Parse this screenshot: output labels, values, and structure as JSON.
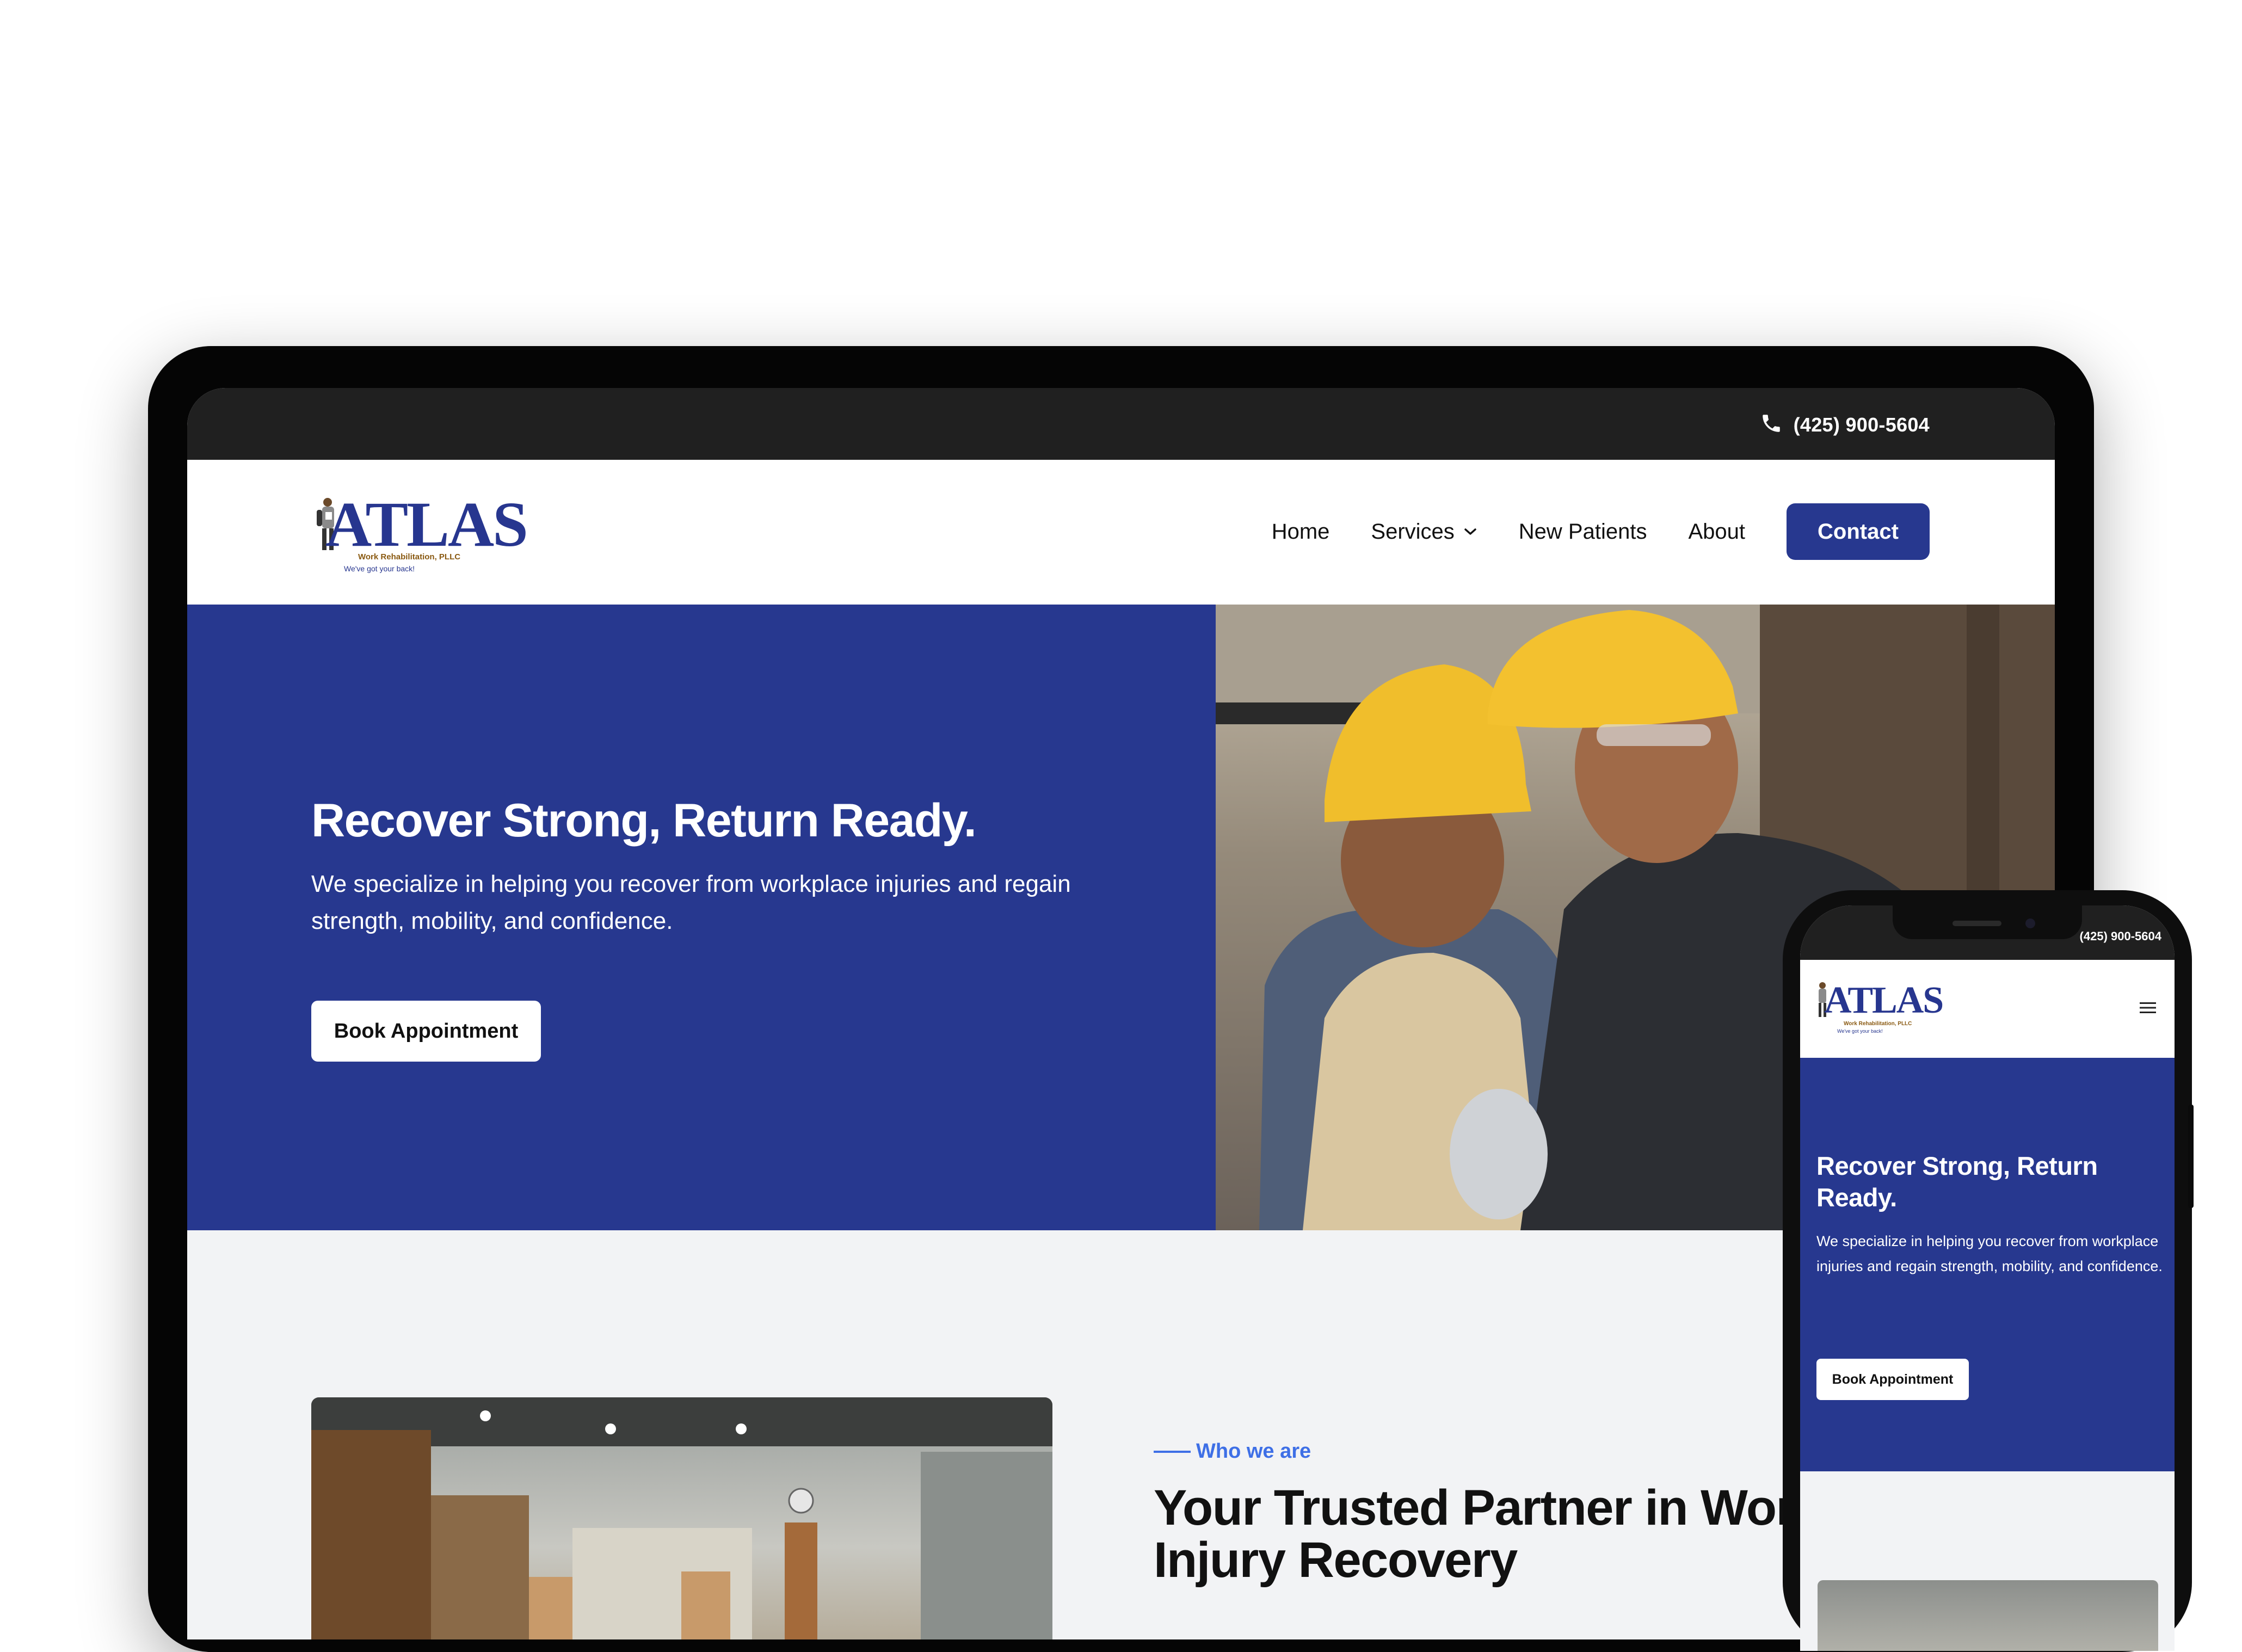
{
  "desktop": {
    "topbar": {
      "phone": "(425) 900-5604",
      "phone_icon": "phone-icon"
    },
    "logo": {
      "word": "ATLAS",
      "sub": "Work Rehabilitation, PLLC",
      "tagline": "We've got your back!"
    },
    "nav": {
      "items": [
        {
          "label": "Home"
        },
        {
          "label": "Services",
          "icon": "chevron-down-icon"
        },
        {
          "label": "New Patients"
        },
        {
          "label": "About"
        }
      ],
      "contact_label": "Contact"
    },
    "hero": {
      "title": "Recover Strong, Return Ready.",
      "description": "We specialize in helping you recover from workplace injuries and regain strength, mobility, and confidence.",
      "cta": "Book Appointment"
    },
    "about": {
      "eyebrow": "Who we are",
      "title": "Your Trusted Partner in Workplace Injury Recovery"
    }
  },
  "mobile": {
    "topbar": {
      "phone": "(425) 900-5604"
    },
    "logo": {
      "word": "ATLAS",
      "sub": "Work Rehabilitation, PLLC",
      "tagline": "We've got your back!"
    },
    "menu_icon": "hamburger-menu-icon",
    "hero": {
      "title": "Recover Strong, Return Ready.",
      "description": "We specialize in helping you recover from workplace injuries and regain strength, mobility, and confidence.",
      "cta": "Book Appointment"
    }
  },
  "colors": {
    "brand_blue": "#27388f",
    "topbar": "#202020",
    "accent": "#3e6fe6",
    "section_bg": "#f2f3f5"
  }
}
